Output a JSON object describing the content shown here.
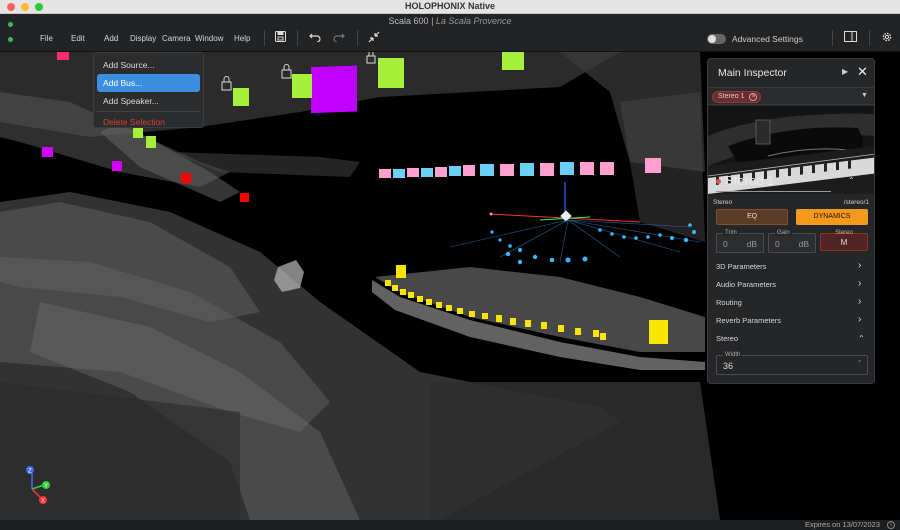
{
  "window": {
    "app_title": "HOLOPHONIX Native",
    "project_name": "Scala 600",
    "separator": "|",
    "venue": "La Scala Provence"
  },
  "menu": {
    "items": [
      "File",
      "Edit",
      "Add",
      "Display",
      "Camera",
      "Window",
      "Help"
    ]
  },
  "toolbar": {
    "icons": [
      "save-icon",
      "undo-icon",
      "redo-icon",
      "collapse-icon"
    ]
  },
  "advanced_settings": {
    "label": "Advanced Settings",
    "enabled": false
  },
  "add_menu": {
    "items": [
      {
        "label": "Add Source...",
        "state": "normal"
      },
      {
        "label": "Add Bus...",
        "state": "highlighted"
      },
      {
        "label": "Add Speaker...",
        "state": "normal"
      },
      {
        "label": "Delete Selection",
        "state": "destructive"
      }
    ]
  },
  "inspector": {
    "title": "Main Inspector",
    "selected_chip": "Stereo 1",
    "source_name": "Stereo 1",
    "type_label": "Stereo",
    "path": "/stereo/1",
    "eq_label": "EQ",
    "dynamics_label": "DYNAMICS",
    "trim": {
      "label": "Trim",
      "value": "0",
      "unit": "dB"
    },
    "gain": {
      "label": "Gain",
      "value": "0",
      "unit": "dB"
    },
    "stereo_mode": {
      "label": "Stereo",
      "value": "M"
    },
    "sections": [
      "3D Parameters",
      "Audio Parameters",
      "Routing",
      "Reverb Parameters",
      "Stereo"
    ],
    "width": {
      "label": "Width",
      "value": "36",
      "unit": "°"
    }
  },
  "axes": {
    "z": "Z",
    "y": "Y",
    "x": "X"
  },
  "status": {
    "expires": "Expires on 13/07/2023"
  },
  "colors": {
    "accent": "#3d8ee0",
    "dynamics": "#f39a1c",
    "source_dot": "#e05050",
    "speaker_yellow": "#f7e600",
    "speaker_pink": "#ff9fd0",
    "speaker_cyan": "#6ad0f5",
    "speaker_green": "#a6ef3a",
    "speaker_purple": "#c000ff"
  }
}
